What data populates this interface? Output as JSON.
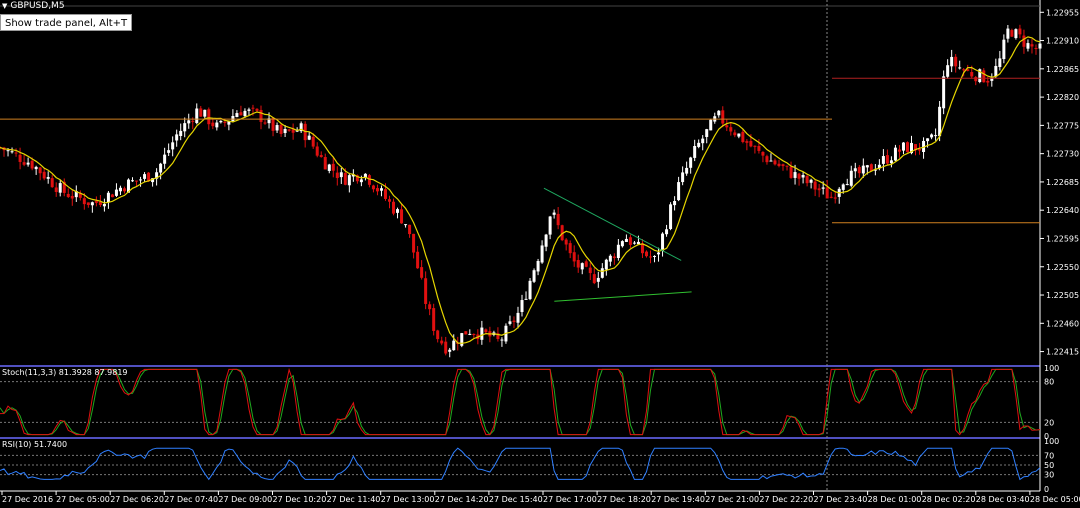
{
  "symbol": "GBPUSD,M5",
  "trade_button": "Show trade panel, Alt+T",
  "stoch_label": "Stoch(11,3,3) 81.3928 87.9819",
  "rsi_label": "RSI(10) 51.7400",
  "stoch_levels": [
    "100",
    "80",
    "20",
    "0"
  ],
  "rsi_levels": [
    "100",
    "70",
    "50",
    "30",
    "0"
  ],
  "colors": {
    "bull": "#ffffff",
    "bear": "#e01010",
    "ma": "#e6d600",
    "stoch_main": "#e01010",
    "stoch_signal": "#1fa81f",
    "rsi": "#2f7fff",
    "hline": "#d08020",
    "hline_red": "#b02020",
    "triangle_upper": "#1fa860",
    "triangle_lower": "#30c030",
    "separator": "#6a6aff"
  },
  "chart_data": {
    "type": "candlestick",
    "symbol": "GBPUSD",
    "timeframe": "M5",
    "price_ticks": [
      "1.22955",
      "1.22910",
      "1.22865",
      "1.22820",
      "1.22775",
      "1.22730",
      "1.22685",
      "1.22640",
      "1.22595",
      "1.22550",
      "1.22505",
      "1.22460",
      "1.22415"
    ],
    "time_ticks": [
      "27 Dec 2016",
      "27 Dec 05:00",
      "27 Dec 06:20",
      "27 Dec 07:40",
      "27 Dec 09:00",
      "27 Dec 10:20",
      "27 Dec 11:40",
      "27 Dec 13:00",
      "27 Dec 14:20",
      "27 Dec 15:40",
      "27 Dec 17:00",
      "27 Dec 18:20",
      "27 Dec 19:40",
      "27 Dec 21:00",
      "27 Dec 22:20",
      "27 Dec 23:40",
      "28 Dec 01:00",
      "28 Dec 02:20",
      "28 Dec 03:40",
      "28 Dec 05:00"
    ],
    "close_path": [
      [
        0,
        1.2274
      ],
      [
        0.03,
        1.22715
      ],
      [
        0.06,
        1.2267
      ],
      [
        0.09,
        1.2265
      ],
      [
        0.12,
        1.2268
      ],
      [
        0.15,
        1.227
      ],
      [
        0.17,
        1.2276
      ],
      [
        0.19,
        1.228
      ],
      [
        0.21,
        1.2277
      ],
      [
        0.23,
        1.228
      ],
      [
        0.25,
        1.2279
      ],
      [
        0.27,
        1.2276
      ],
      [
        0.29,
        1.2277
      ],
      [
        0.31,
        1.2272
      ],
      [
        0.33,
        1.2269
      ],
      [
        0.35,
        1.227
      ],
      [
        0.37,
        1.2266
      ],
      [
        0.39,
        1.2262
      ],
      [
        0.4,
        1.2256
      ],
      [
        0.41,
        1.2249
      ],
      [
        0.42,
        1.2244
      ],
      [
        0.43,
        1.2242
      ],
      [
        0.45,
        1.2245
      ],
      [
        0.47,
        1.2244
      ],
      [
        0.48,
        1.2243
      ],
      [
        0.5,
        1.2248
      ],
      [
        0.52,
        1.2258
      ],
      [
        0.53,
        1.2264
      ],
      [
        0.54,
        1.226
      ],
      [
        0.55,
        1.2256
      ],
      [
        0.57,
        1.2253
      ],
      [
        0.59,
        1.2257
      ],
      [
        0.6,
        1.226
      ],
      [
        0.62,
        1.2257
      ],
      [
        0.63,
        1.2256
      ],
      [
        0.65,
        1.2267
      ],
      [
        0.67,
        1.2274
      ],
      [
        0.69,
        1.2279
      ],
      [
        0.71,
        1.2276
      ],
      [
        0.73,
        1.2273
      ],
      [
        0.75,
        1.2271
      ],
      [
        0.77,
        1.2269
      ],
      [
        0.79,
        1.2267
      ],
      [
        0.8,
        1.2266
      ],
      [
        0.81,
        1.2269
      ],
      [
        0.83,
        1.227
      ],
      [
        0.85,
        1.2272
      ],
      [
        0.87,
        1.2274
      ],
      [
        0.89,
        1.2274
      ],
      [
        0.9,
        1.2276
      ],
      [
        0.91,
        1.2288
      ],
      [
        0.93,
        1.2286
      ],
      [
        0.95,
        1.2285
      ],
      [
        0.96,
        1.2287
      ],
      [
        0.97,
        1.2293
      ],
      [
        0.99,
        1.229
      ],
      [
        1.0,
        1.22895
      ]
    ],
    "horizontal_lines": [
      {
        "price": 1.22785,
        "color": "hline",
        "from": 0,
        "to": 0.8
      },
      {
        "price": 1.2285,
        "color": "hline_red",
        "from": 0.8,
        "to": 1.0
      },
      {
        "price": 1.2262,
        "color": "hline",
        "from": 0.8,
        "to": 1.0
      }
    ],
    "triangle": {
      "upper": [
        [
          0.523,
          1.22675
        ],
        [
          0.655,
          1.2256
        ]
      ],
      "lower": [
        [
          0.533,
          1.22495
        ],
        [
          0.665,
          1.2251
        ]
      ]
    },
    "stochastic": {
      "k": 81.3928,
      "d": 87.9819,
      "levels": [
        80,
        20
      ]
    },
    "rsi": {
      "value": 51.74,
      "levels": [
        70,
        50,
        30
      ]
    }
  }
}
